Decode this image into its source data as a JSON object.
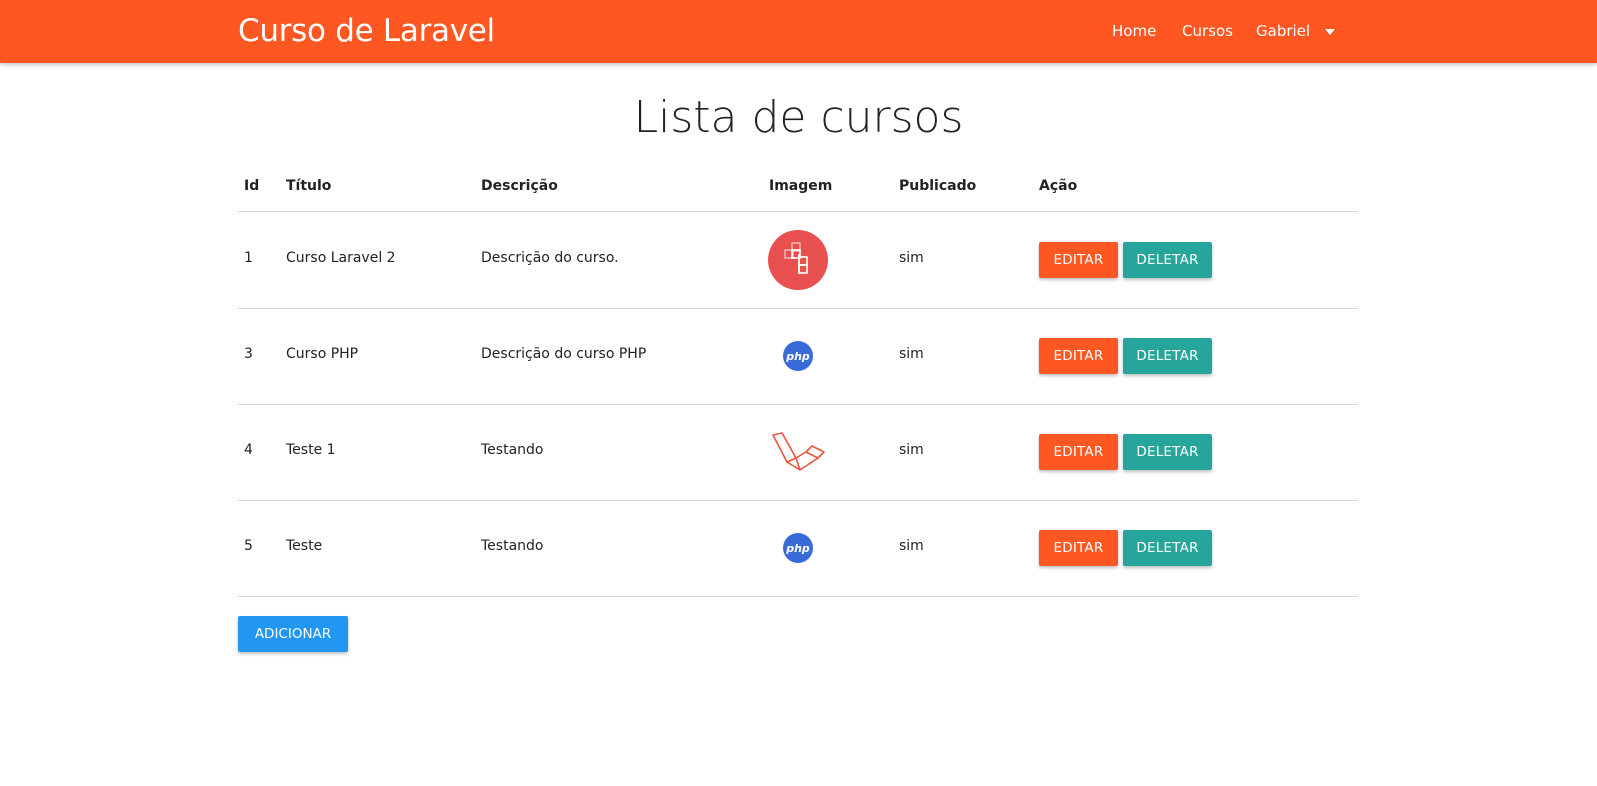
{
  "navbar": {
    "brand": "Curso de Laravel",
    "links": [
      "Home",
      "Cursos",
      "Gabriel"
    ],
    "color": "#ff5722"
  },
  "page_title": "Lista de cursos",
  "table": {
    "headers": [
      "Id",
      "Título",
      "Descrição",
      "Imagem",
      "Publicado",
      "Ação"
    ],
    "rows": [
      {
        "id": "1",
        "titulo": "Curso Laravel 2",
        "descricao": "Descrição do curso.",
        "imagem": "rails-style-logo-icon",
        "publicado": "sim",
        "edit": "EDITAR",
        "delete": "DELETAR"
      },
      {
        "id": "3",
        "titulo": "Curso PHP",
        "descricao": "Descrição do curso PHP",
        "imagem": "php-logo-icon",
        "publicado": "sim",
        "edit": "EDITAR",
        "delete": "DELETAR"
      },
      {
        "id": "4",
        "titulo": "Teste 1",
        "descricao": "Testando",
        "imagem": "laravel-logo-icon",
        "publicado": "sim",
        "edit": "EDITAR",
        "delete": "DELETAR"
      },
      {
        "id": "5",
        "titulo": "Teste",
        "descricao": "Testando",
        "imagem": "php-logo-icon",
        "publicado": "sim",
        "edit": "EDITAR",
        "delete": "DELETAR"
      }
    ]
  },
  "add_button": "ADICIONAR",
  "colors": {
    "edit": "#ff5722",
    "delete": "#26a69a",
    "add": "#2196f3"
  }
}
